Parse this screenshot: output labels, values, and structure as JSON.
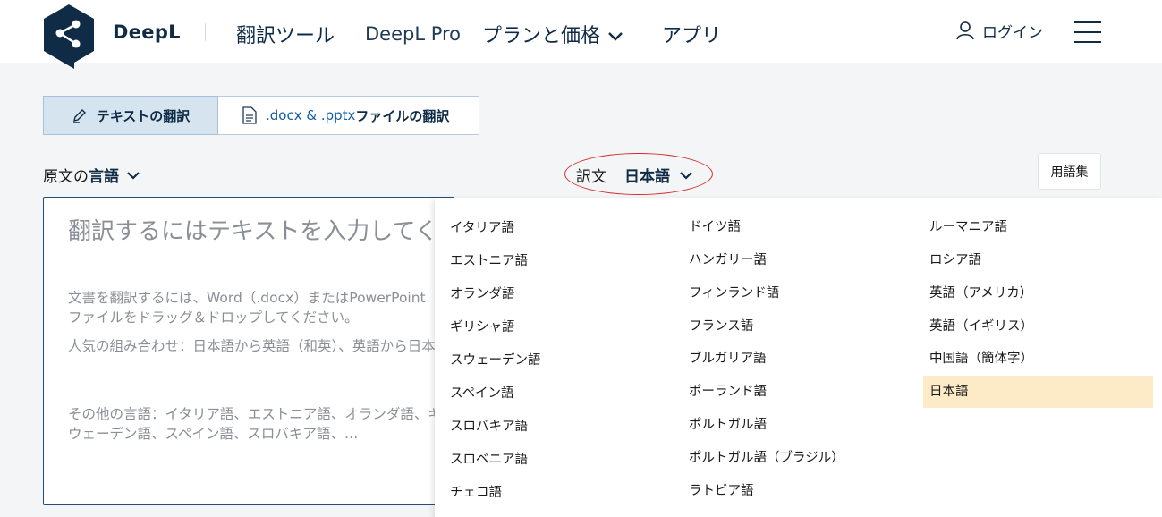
{
  "header": {
    "brand": "DeepL",
    "nav": [
      "翻訳ツール",
      "DeepL Pro",
      "プランと価格",
      "アプリ"
    ],
    "login": "ログイン"
  },
  "tabs": {
    "text": "テキストの翻訳",
    "file_ext": ".docx & .pptx",
    "file_suffix": "ファイルの翻訳"
  },
  "source_lang": {
    "prefix": "原文の",
    "bold": "言語"
  },
  "target_lang": {
    "prefix": "訳文",
    "value": "日本語"
  },
  "glossary": "用語集",
  "source_box": {
    "placeholder": "翻訳するにはテキストを入力してください。",
    "hint1": "文書を翻訳するには、Word（.docx）またはPowerPoint（.pptx）形式のファイルをドラッグ＆ドロップしてください。",
    "hint2": "人気の組み合わせ：日本語から英語（和英）、英語から日本語（英和）",
    "hint3": "その他の言語：イタリア語、エストニア語、オランダ語、ギリシャ語、スウェーデン語、スペイン語、スロバキア語、…"
  },
  "languages": {
    "col1": [
      "イタリア語",
      "エストニア語",
      "オランダ語",
      "ギリシャ語",
      "スウェーデン語",
      "スペイン語",
      "スロバキア語",
      "スロベニア語",
      "チェコ語"
    ],
    "col2": [
      "ドイツ語",
      "ハンガリー語",
      "フィンランド語",
      "フランス語",
      "ブルガリア語",
      "ポーランド語",
      "ポルトガル語",
      "ポルトガル語（ブラジル）",
      "ラトビア語"
    ],
    "col3": [
      "ルーマニア語",
      "ロシア語",
      "英語（アメリカ）",
      "英語（イギリス）",
      "中国語（簡体字）",
      "日本語"
    ],
    "selected": "日本語"
  },
  "colors": {
    "brand": "#0f2b46",
    "accent": "#0f5ea7",
    "selected_bg": "#fdebc8",
    "annotation": "#d32f2f"
  }
}
